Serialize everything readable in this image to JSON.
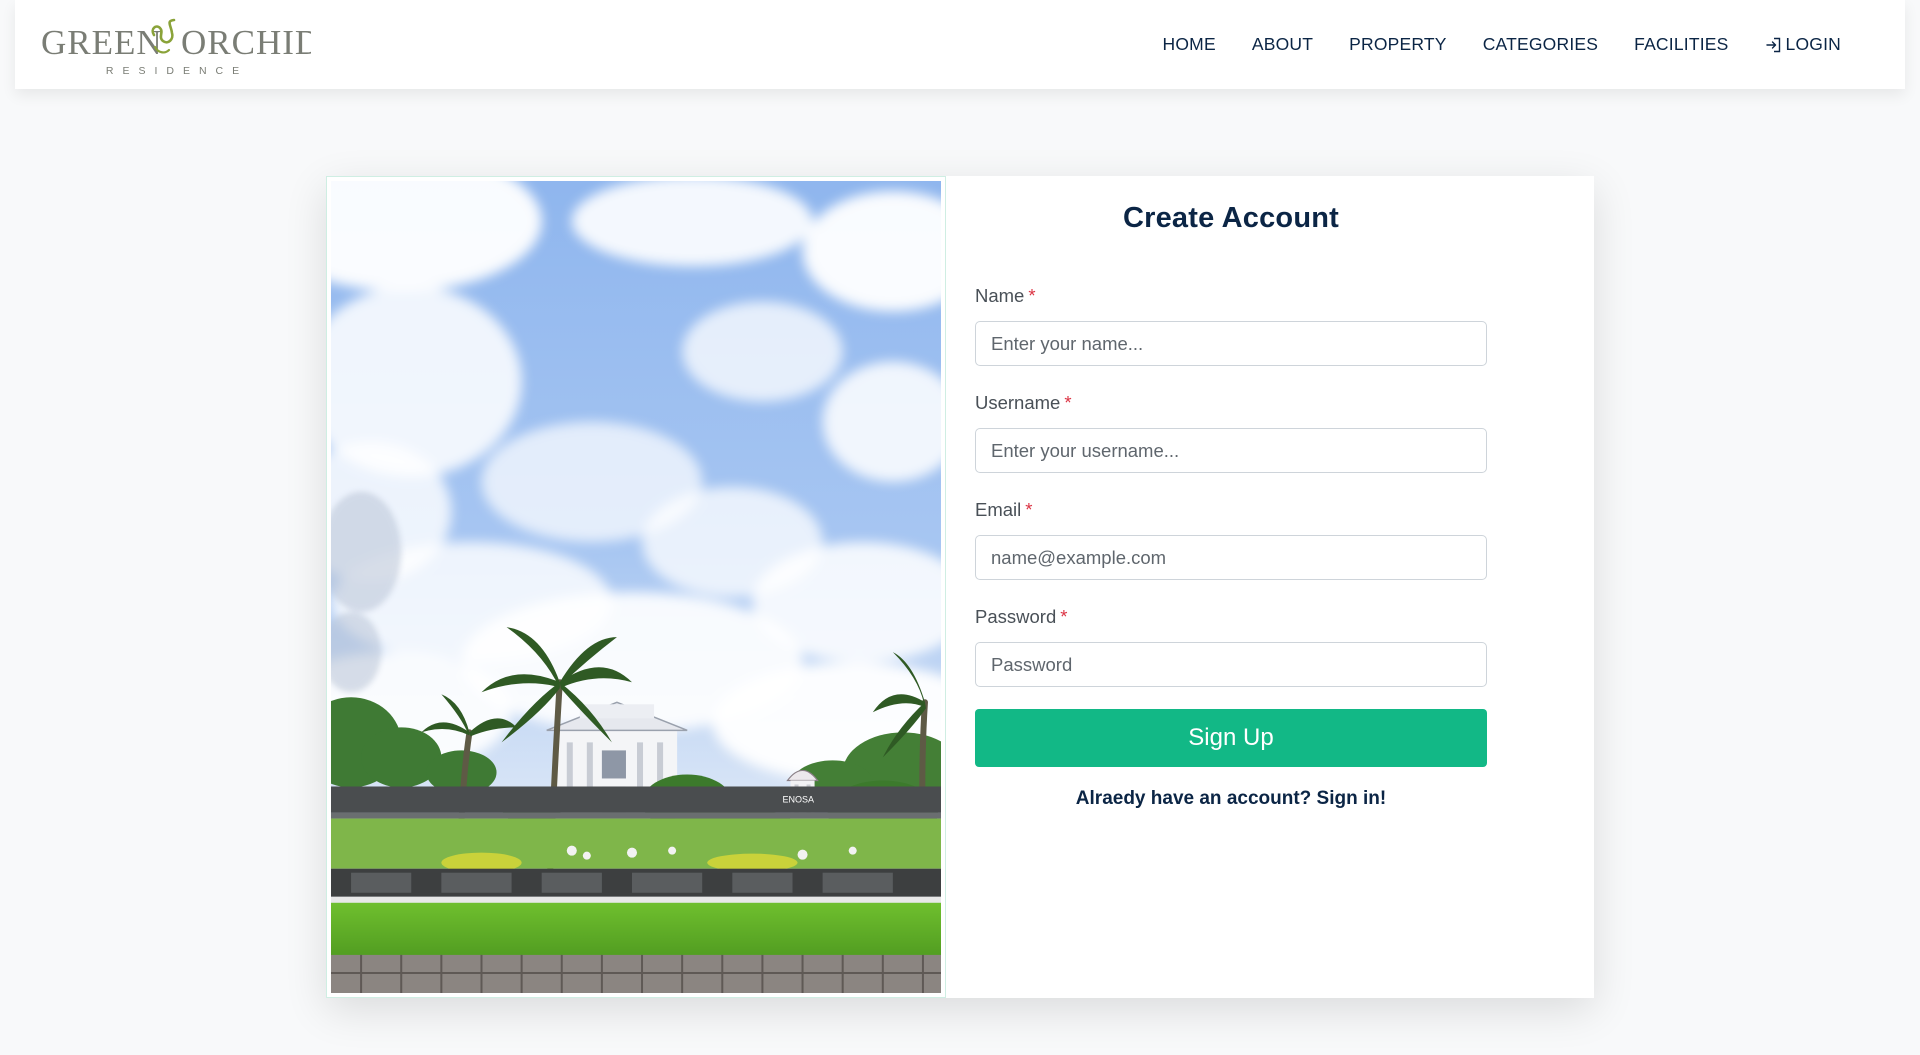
{
  "brand": {
    "name_left": "GREEN",
    "name_right": "ORCHID",
    "tagline": "RESIDENCE"
  },
  "nav": {
    "items": [
      {
        "label": "HOME"
      },
      {
        "label": "ABOUT"
      },
      {
        "label": "PROPERTY"
      },
      {
        "label": "CATEGORIES"
      },
      {
        "label": "FACILITIES"
      }
    ],
    "login_label": "LOGIN"
  },
  "hero_image": {
    "content": "Residence clubhouse with palm trees under a cloudy blue sky",
    "icon": "photo",
    "sign_text": "ENOSA"
  },
  "form": {
    "title": "Create Account",
    "required_marker": "*",
    "name": {
      "label": "Name",
      "placeholder": "Enter your name..."
    },
    "username": {
      "label": "Username",
      "placeholder": "Enter your username..."
    },
    "email": {
      "label": "Email",
      "placeholder": "name@example.com"
    },
    "password": {
      "label": "Password",
      "placeholder": "Password"
    },
    "submit_label": "Sign Up",
    "signin_text": "Alraedy have an account? Sign in!"
  },
  "colors": {
    "primary_navy": "#0b2545",
    "accent_green": "#12b886",
    "required_red": "#dc3545",
    "page_bg": "#f8f9fa",
    "logo_gray": "#7a7d75",
    "logo_green": "#8aa339"
  }
}
